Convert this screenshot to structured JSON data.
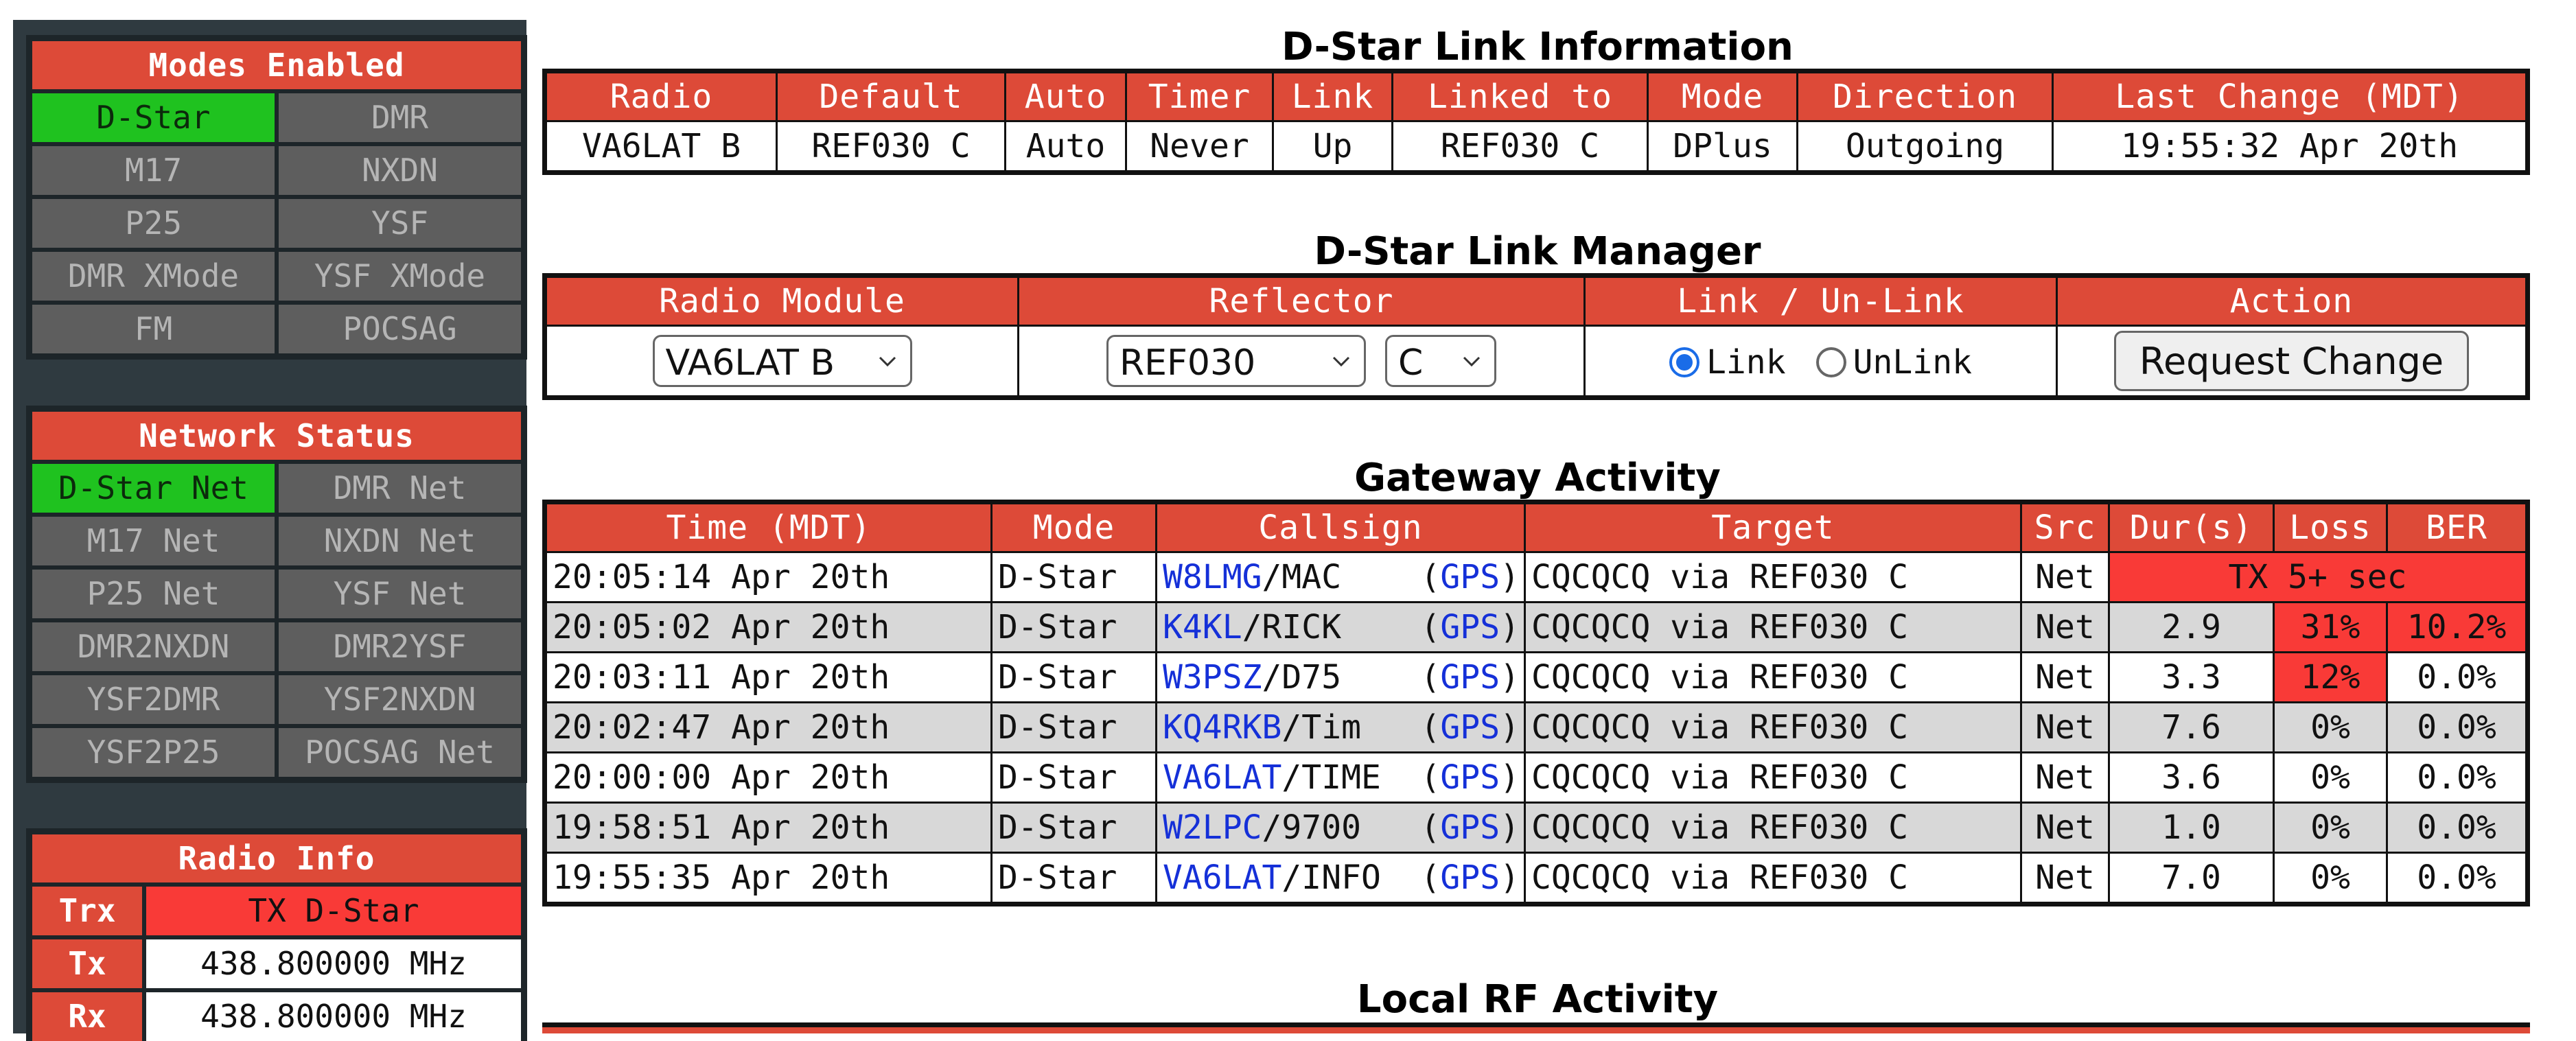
{
  "modes": {
    "title": "Modes Enabled",
    "items": [
      {
        "label": "D-Star",
        "on": true
      },
      {
        "label": "DMR",
        "on": false
      },
      {
        "label": "M17",
        "on": false
      },
      {
        "label": "NXDN",
        "on": false
      },
      {
        "label": "P25",
        "on": false
      },
      {
        "label": "YSF",
        "on": false
      },
      {
        "label": "DMR XMode",
        "on": false
      },
      {
        "label": "YSF XMode",
        "on": false
      },
      {
        "label": "FM",
        "on": false
      },
      {
        "label": "POCSAG",
        "on": false
      }
    ]
  },
  "network": {
    "title": "Network Status",
    "items": [
      {
        "label": "D-Star Net",
        "on": true
      },
      {
        "label": "DMR Net",
        "on": false
      },
      {
        "label": "M17 Net",
        "on": false
      },
      {
        "label": "NXDN Net",
        "on": false
      },
      {
        "label": "P25 Net",
        "on": false
      },
      {
        "label": "YSF Net",
        "on": false
      },
      {
        "label": "DMR2NXDN",
        "on": false
      },
      {
        "label": "DMR2YSF",
        "on": false
      },
      {
        "label": "YSF2DMR",
        "on": false
      },
      {
        "label": "YSF2NXDN",
        "on": false
      },
      {
        "label": "YSF2P25",
        "on": false
      },
      {
        "label": "POCSAG Net",
        "on": false
      }
    ]
  },
  "radio_info": {
    "title": "Radio Info",
    "rows": [
      {
        "label": "Trx",
        "value": "TX D-Star"
      },
      {
        "label": "Tx",
        "value": "438.800000 MHz"
      },
      {
        "label": "Rx",
        "value": "438.800000 MHz"
      }
    ]
  },
  "link_info": {
    "title": "D-Star Link Information",
    "headers": [
      "Radio",
      "Default",
      "Auto",
      "Timer",
      "Link",
      "Linked to",
      "Mode",
      "Direction",
      "Last Change (MDT)"
    ],
    "row": [
      "VA6LAT B",
      "REF030 C",
      "Auto",
      "Never",
      "Up",
      "REF030 C",
      "DPlus",
      "Outgoing",
      "19:55:32 Apr 20th"
    ]
  },
  "link_manager": {
    "title": "D-Star Link Manager",
    "headers": [
      "Radio Module",
      "Reflector",
      "Link / Un-Link",
      "Action"
    ],
    "radio_module": "VA6LAT B",
    "reflector": "REF030",
    "module": "C",
    "link_label": "Link",
    "unlink_label": "UnLink",
    "selected": "Link",
    "action_label": "Request Change"
  },
  "gateway": {
    "title": "Gateway Activity",
    "headers": [
      "Time (MDT)",
      "Mode",
      "Callsign",
      "Target",
      "Src",
      "Dur(s)",
      "Loss",
      "BER"
    ],
    "gps_label": "GPS",
    "rows": [
      {
        "time": "20:05:14 Apr 20th",
        "mode": "D-Star",
        "call": "W8LMG",
        "suffix": "/MAC",
        "target": "CQCQCQ via REF030 C",
        "src": "Net",
        "tx": "TX 5+ sec"
      },
      {
        "time": "20:05:02 Apr 20th",
        "mode": "D-Star",
        "call": "K4KL",
        "suffix": "/RICK",
        "target": "CQCQCQ via REF030 C",
        "src": "Net",
        "dur": "2.9",
        "loss": "31%",
        "ber": "10.2%",
        "loss_bad": true,
        "ber_bad": true
      },
      {
        "time": "20:03:11 Apr 20th",
        "mode": "D-Star",
        "call": "W3PSZ",
        "suffix": "/D75",
        "target": "CQCQCQ via REF030 C",
        "src": "Net",
        "dur": "3.3",
        "loss": "12%",
        "ber": "0.0%",
        "loss_bad": true,
        "ber_bad": false
      },
      {
        "time": "20:02:47 Apr 20th",
        "mode": "D-Star",
        "call": "KQ4RKB",
        "suffix": "/Tim",
        "target": "CQCQCQ via REF030 C",
        "src": "Net",
        "dur": "7.6",
        "loss": "0%",
        "ber": "0.0%"
      },
      {
        "time": "20:00:00 Apr 20th",
        "mode": "D-Star",
        "call": "VA6LAT",
        "suffix": "/TIME",
        "target": "CQCQCQ via REF030 C",
        "src": "Net",
        "dur": "3.6",
        "loss": "0%",
        "ber": "0.0%"
      },
      {
        "time": "19:58:51 Apr 20th",
        "mode": "D-Star",
        "call": "W2LPC",
        "suffix": "/9700",
        "target": "CQCQCQ via REF030 C",
        "src": "Net",
        "dur": "1.0",
        "loss": "0%",
        "ber": "0.0%"
      },
      {
        "time": "19:55:35 Apr 20th",
        "mode": "D-Star",
        "call": "VA6LAT",
        "suffix": "/INFO",
        "target": "CQCQCQ via REF030 C",
        "src": "Net",
        "dur": "7.0",
        "loss": "0%",
        "ber": "0.0%"
      }
    ]
  },
  "local_rf": {
    "title": "Local RF Activity"
  },
  "colors": {
    "header_red": "#dd4a38",
    "active_green": "#1fc21f",
    "alert_red": "#f93a37",
    "link_blue": "#1530d8"
  }
}
